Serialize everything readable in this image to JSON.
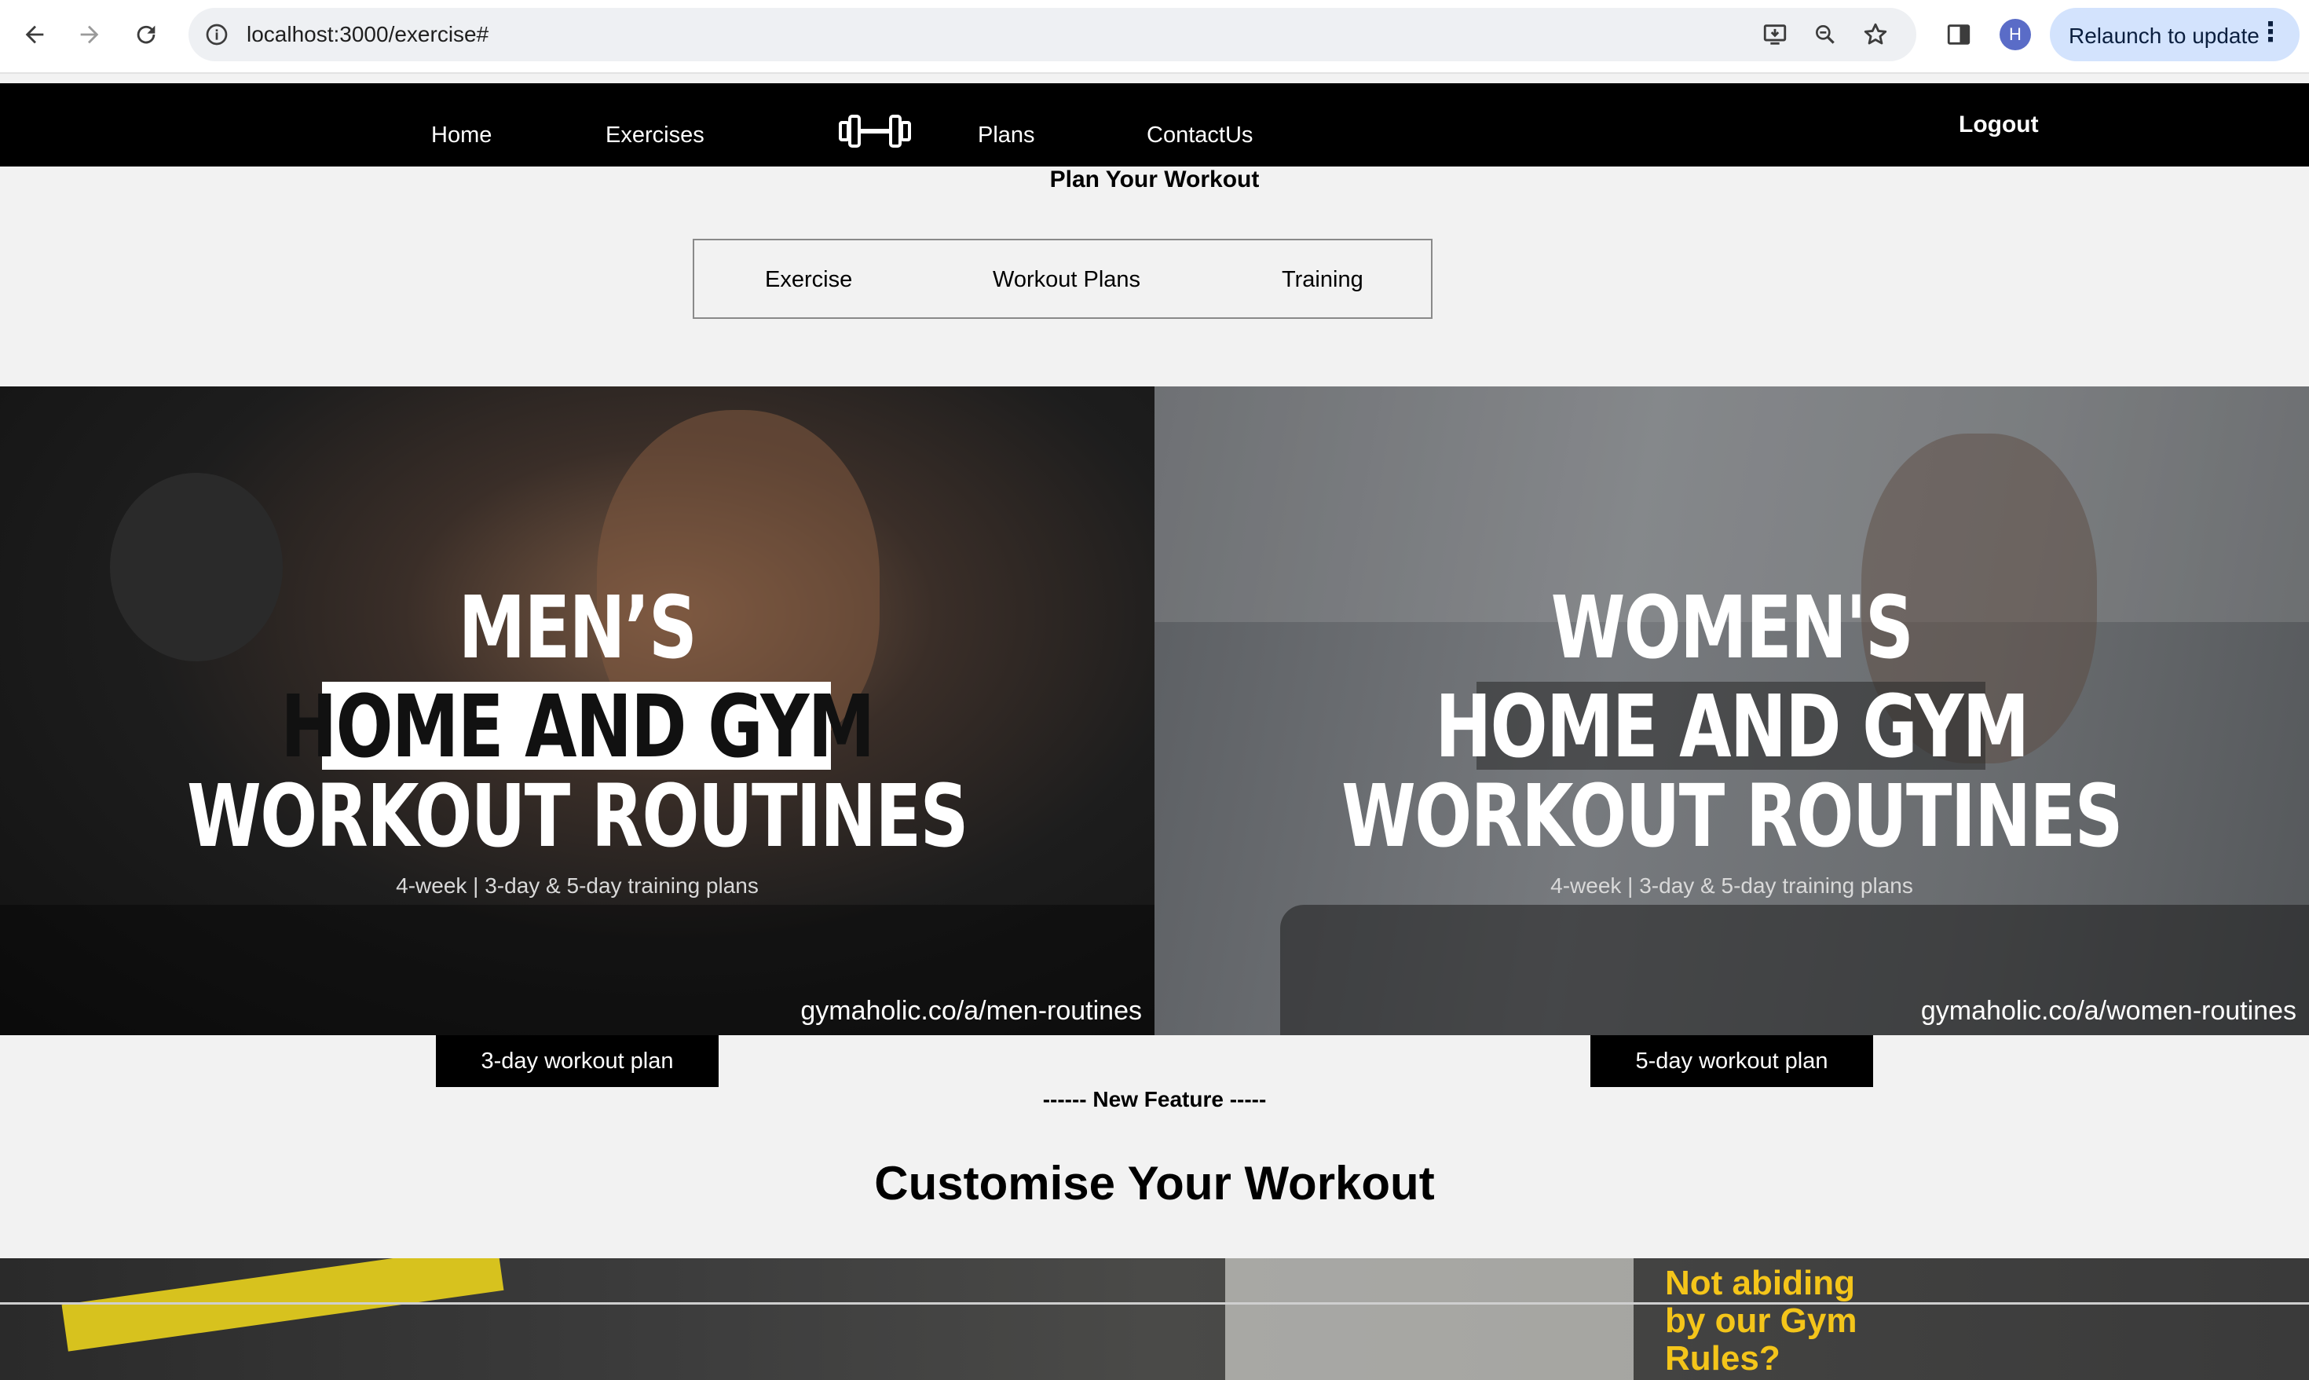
{
  "browser": {
    "url": "localhost:3000/exercise#",
    "avatar_initial": "H",
    "relaunch_label": "Relaunch to update"
  },
  "site_nav": {
    "links": [
      "Home",
      "Exercises",
      "Plans",
      "ContactUs"
    ],
    "logout": "Logout"
  },
  "planner": {
    "title": "Plan Your Workout",
    "tabs": [
      "Exercise",
      "Workout Plans",
      "Training"
    ]
  },
  "banners": [
    {
      "line1": "MEN’S",
      "line2": "HOME AND GYM",
      "line3": "WORKOUT ROUTINES",
      "subtitle": "4-week | 3-day & 5-day training plans",
      "link": "gymaholic.co/a/men-routines",
      "button": "3-day workout plan"
    },
    {
      "line1": "WOMEN'S",
      "line2": "HOME AND GYM",
      "line3": "WORKOUT ROUTINES",
      "subtitle": "4-week | 3-day & 5-day training plans",
      "link": "gymaholic.co/a/women-routines",
      "button": "5-day workout plan"
    }
  ],
  "new_feature": "------ New Feature -----",
  "customise_title": "Customise Your Workout",
  "gym_sign": "Not abiding by our Gym Rules?"
}
